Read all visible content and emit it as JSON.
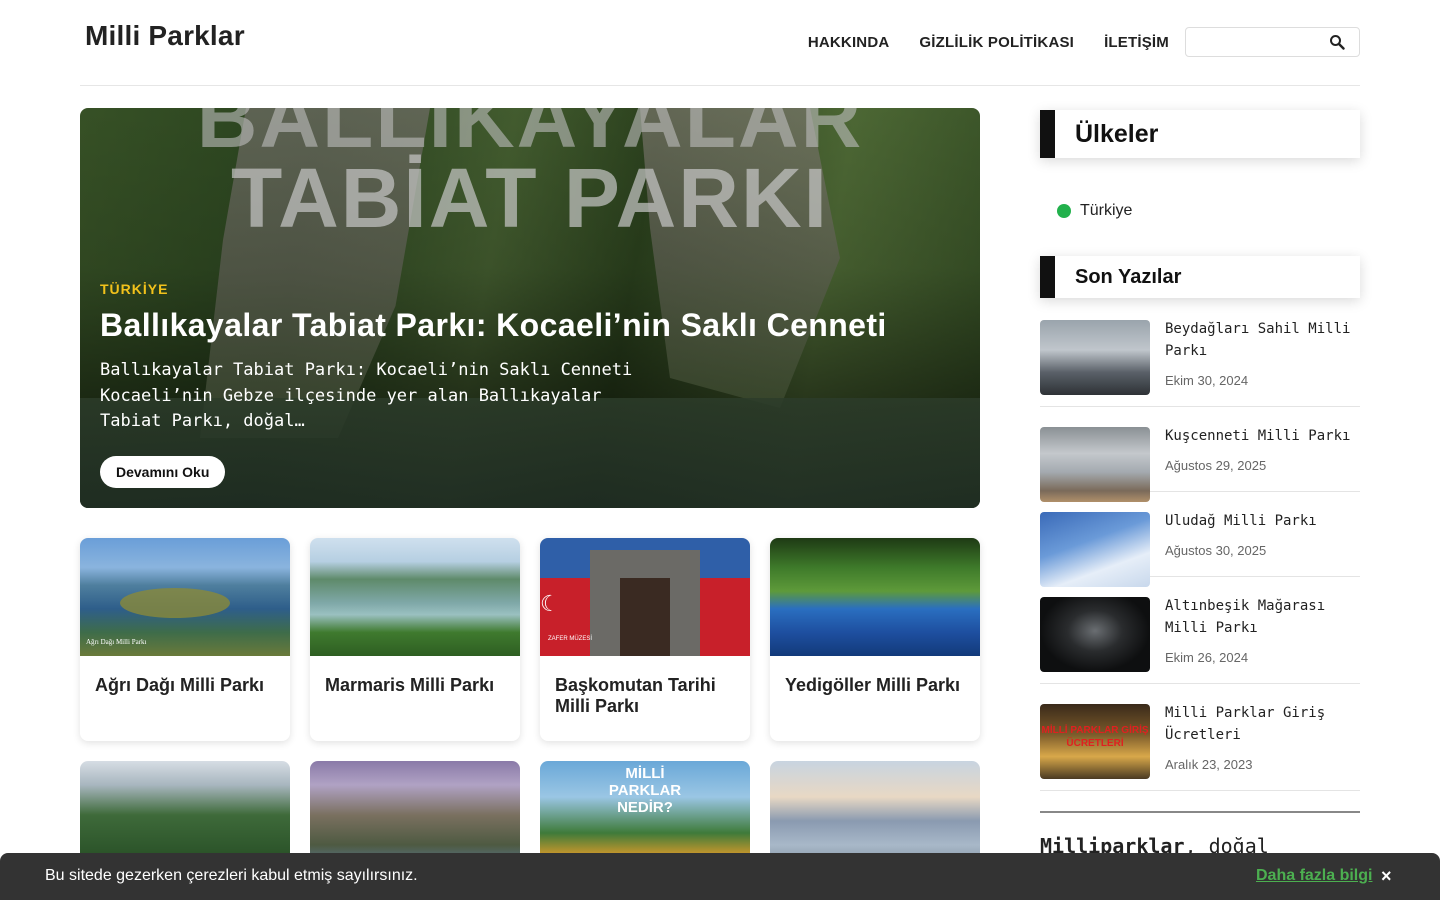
{
  "site": {
    "title": "Milli Parklar"
  },
  "nav": {
    "items": [
      "HAKKINDA",
      "GİZLİLİK POLİTİKASI",
      "İLETİŞİM"
    ]
  },
  "search": {
    "value": "",
    "icon": "search-icon"
  },
  "hero": {
    "overlay_line1": "BALLIKAYALAR",
    "overlay_line2": "TABİAT PARKI",
    "category": "TÜRKİYE",
    "title": "Ballıkayalar Tabiat Parkı: Kocaeli’nin Saklı Cenneti",
    "excerpt_lines": [
      "Ballıkayalar Tabiat Parkı: Kocaeli’nin Saklı Cenneti",
      "Kocaeli’nin Gebze ilçesinde yer alan Ballıkayalar",
      "Tabiat Parkı, doğal…"
    ],
    "button": "Devamını Oku"
  },
  "cards": [
    {
      "title": "Ağrı Dağı Milli Parkı",
      "thumb_caption": "Ağrı Dağı Milli Parkı"
    },
    {
      "title": "Marmaris Milli Parkı"
    },
    {
      "title": "Başkomutan Tarihi Milli Parkı",
      "thumb_caption": "ZAFER MÜZESİ"
    },
    {
      "title": "Yedigöller Milli Parkı"
    }
  ],
  "cards_row2": [
    {
      "overlay": ""
    },
    {
      "overlay": ""
    },
    {
      "overlay": "MİLLİ PARKLAR NEDİR?"
    },
    {
      "overlay": ""
    }
  ],
  "sidebar": {
    "countries_heading": "Ülkeler",
    "countries": [
      {
        "name": "Türkiye",
        "color": "#22b14c"
      }
    ],
    "recent_heading": "Son Yazılar",
    "recent_posts": [
      {
        "title": "Beydağları Sahil Milli Parkı",
        "date": "Ekim 30, 2024"
      },
      {
        "title": "Kuşcenneti Milli Parkı",
        "date": "Ağustos 29, 2025"
      },
      {
        "title": "Uludağ Milli Parkı",
        "date": "Ağustos 30, 2025"
      },
      {
        "title": "Altınbeşik Mağarası Milli Parkı",
        "date": "Ekim 26, 2024"
      },
      {
        "title": "Milli Parklar Giriş Ücretleri",
        "date": "Aralık 23, 2023",
        "thumb_text": "MİLLİ PARKLAR GİRİŞ ÜCRETLERİ"
      }
    ],
    "about_bold": "Milliparklar",
    "about_rest": ", doğal"
  },
  "cookie": {
    "message": "Bu sitede gezerken çerezleri kabul etmiş sayılırsınız.",
    "more": "Daha fazla bilgi",
    "close": "×"
  },
  "colors": {
    "accent": "#f2c21b",
    "cookie_bg": "#333333",
    "link_green": "#4caf50",
    "widget_bar": "#111111"
  }
}
